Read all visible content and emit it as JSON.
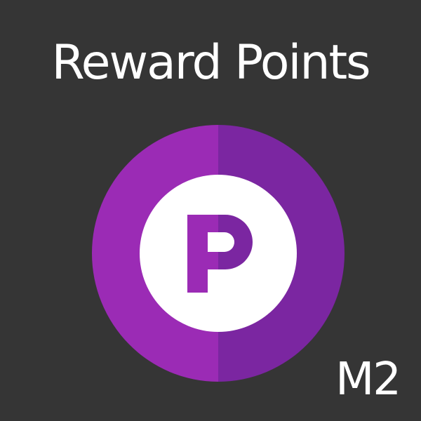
{
  "header": {
    "title": "Reward Points"
  },
  "logo": {
    "icon": "points-p-icon",
    "letter": "P",
    "colors": {
      "background": "#353535",
      "ring_left": "#9b2bb5",
      "ring_right": "#7b26a1",
      "inner_circle": "#ffffff",
      "letter_left": "#9b2bb5",
      "letter_right": "#7b26a1"
    }
  },
  "badge": {
    "label": "M2"
  }
}
